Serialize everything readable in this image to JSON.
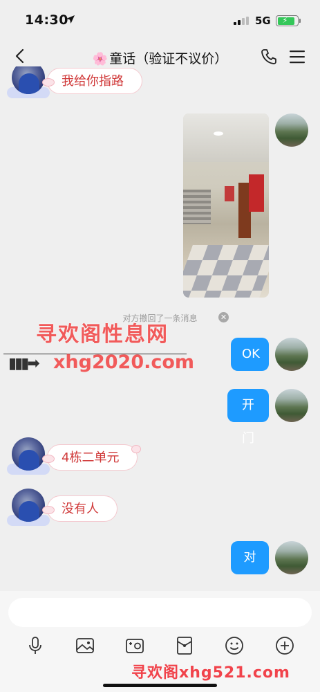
{
  "status_bar": {
    "time": "14:30",
    "network": "5G"
  },
  "nav": {
    "title": "童话（验证不议价）",
    "title_icon": "🌸"
  },
  "messages": [
    {
      "from": "friend",
      "text": "我给你指路"
    },
    {
      "from": "self",
      "type": "image"
    },
    {
      "from": "system",
      "text": "对方撤回了一条消息"
    },
    {
      "from": "self",
      "text": "OK"
    },
    {
      "from": "self",
      "text": "开门"
    },
    {
      "from": "friend",
      "text": "4栋二单元"
    },
    {
      "from": "friend",
      "text": "没有人"
    },
    {
      "from": "self",
      "text": "对"
    }
  ],
  "watermarks": {
    "line1": "寻欢阁性息网",
    "line2": "xhg2020.com",
    "line3": "寻欢阁xhg521.com"
  },
  "toolbar": [
    "microphone-icon",
    "picture-icon",
    "camera-icon",
    "red-packet-icon",
    "emoji-icon",
    "plus-icon"
  ],
  "colors": {
    "self_bubble": "#1e9bff",
    "friend_text": "#d03a3a",
    "watermark": "#f15a5a"
  }
}
